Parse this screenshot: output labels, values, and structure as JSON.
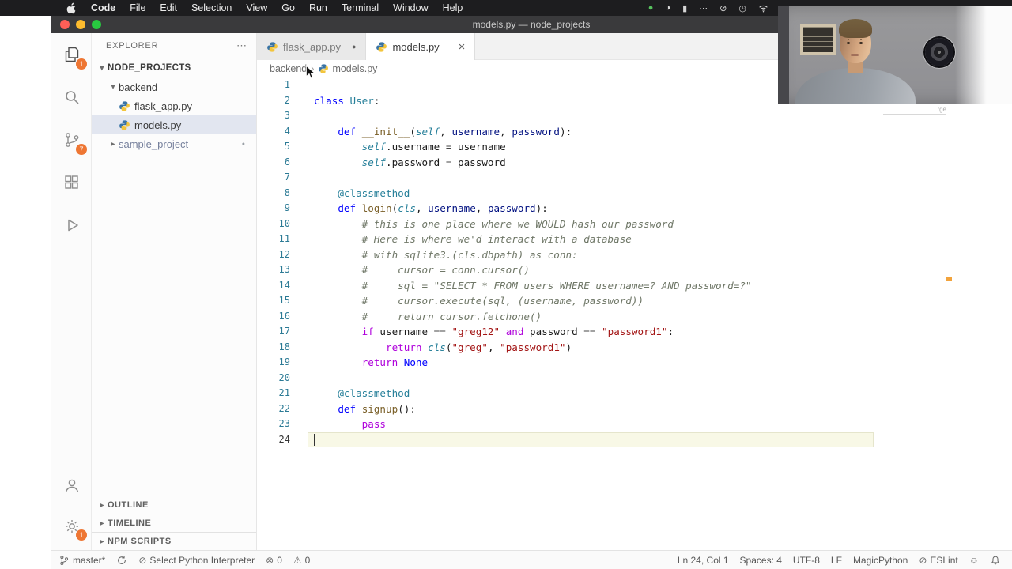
{
  "colors": {
    "badge": "#ee7633",
    "overview_marker": "#f2a33c",
    "selection": "#e2e6f0"
  },
  "icons": {
    "chevron_down": "▾",
    "chevron_right": "▸",
    "ellipsis": "⋯",
    "modified_dot": "●",
    "close": "×",
    "breadcrumb_sep": "›",
    "error": "⊗",
    "warning": "⚠",
    "blocked": "⊘",
    "smiley": "☺"
  },
  "menu_bar": {
    "items": [
      "Code",
      "File",
      "Edit",
      "Selection",
      "View",
      "Go",
      "Run",
      "Terminal",
      "Window",
      "Help"
    ],
    "status_icons": [
      {
        "name": "status-green-icon",
        "glyph": "●",
        "color": "#57c25e"
      },
      {
        "name": "status-dark-icon",
        "glyph": "◑"
      },
      {
        "name": "battery-icon",
        "glyph": "▮"
      },
      {
        "name": "more-menu-icon",
        "glyph": "⋯"
      },
      {
        "name": "dnd-icon",
        "glyph": "⊘"
      },
      {
        "name": "clock-icon",
        "glyph": "◷"
      },
      {
        "name": "wifi-icon",
        "glyph": "@wifi"
      }
    ]
  },
  "title_bar": {
    "title": "models.py — node_projects"
  },
  "activity_bar": {
    "top": [
      {
        "name": "explorer",
        "icon": "files",
        "badge": "1",
        "active": true
      },
      {
        "name": "search",
        "icon": "search"
      },
      {
        "name": "source-control",
        "icon": "scm",
        "badge": "7"
      },
      {
        "name": "extensions",
        "icon": "extensions"
      },
      {
        "name": "run-debug",
        "icon": "run"
      }
    ],
    "bottom": [
      {
        "name": "account",
        "icon": "account"
      },
      {
        "name": "settings",
        "icon": "gear",
        "badge": "1"
      }
    ]
  },
  "explorer": {
    "title": "EXPLORER",
    "root_label": "NODE_PROJECTS",
    "items": [
      {
        "label": "backend",
        "kind": "folder-open",
        "depth": 1
      },
      {
        "label": "flask_app.py",
        "kind": "file-python",
        "depth": 2
      },
      {
        "label": "models.py",
        "kind": "file-python",
        "depth": 2,
        "selected": true
      },
      {
        "label": "sample_project",
        "kind": "folder-closed",
        "depth": 1,
        "muted": true,
        "badge_dot": true
      }
    ],
    "sections": [
      "OUTLINE",
      "TIMELINE",
      "NPM SCRIPTS"
    ]
  },
  "editor_tabs": [
    {
      "label": "flask_app.py",
      "modified": true,
      "active": false
    },
    {
      "label": "models.py",
      "modified": false,
      "active": true
    }
  ],
  "breadcrumb": [
    "backend",
    "models.py"
  ],
  "editor": {
    "cursor_line": 24,
    "lines": [
      [],
      [
        [
          "kw",
          "class"
        ],
        [
          "txt",
          " "
        ],
        [
          "cls",
          "User"
        ],
        [
          "txt",
          ":"
        ]
      ],
      [],
      [
        [
          "txt",
          "    "
        ],
        [
          "kw",
          "def"
        ],
        [
          "txt",
          " "
        ],
        [
          "fn",
          "__init__"
        ],
        [
          "txt",
          "("
        ],
        [
          "self",
          "self"
        ],
        [
          "txt",
          ", "
        ],
        [
          "param",
          "username"
        ],
        [
          "txt",
          ", "
        ],
        [
          "param",
          "password"
        ],
        [
          "txt",
          "):"
        ]
      ],
      [
        [
          "txt",
          "        "
        ],
        [
          "self",
          "self"
        ],
        [
          "txt",
          ".username "
        ],
        [
          "op",
          "="
        ],
        [
          "txt",
          " username"
        ]
      ],
      [
        [
          "txt",
          "        "
        ],
        [
          "self",
          "self"
        ],
        [
          "txt",
          ".password "
        ],
        [
          "op",
          "="
        ],
        [
          "txt",
          " password"
        ]
      ],
      [],
      [
        [
          "txt",
          "    "
        ],
        [
          "dec",
          "@classmethod"
        ]
      ],
      [
        [
          "txt",
          "    "
        ],
        [
          "kw",
          "def"
        ],
        [
          "txt",
          " "
        ],
        [
          "fn",
          "login"
        ],
        [
          "txt",
          "("
        ],
        [
          "self",
          "cls"
        ],
        [
          "txt",
          ", "
        ],
        [
          "param",
          "username"
        ],
        [
          "txt",
          ", "
        ],
        [
          "param",
          "password"
        ],
        [
          "txt",
          "):"
        ]
      ],
      [
        [
          "txt",
          "        "
        ],
        [
          "com",
          "# this is one place where we WOULD hash our password"
        ]
      ],
      [
        [
          "txt",
          "        "
        ],
        [
          "com",
          "# Here is where we'd interact with a database"
        ]
      ],
      [
        [
          "txt",
          "        "
        ],
        [
          "com",
          "# with sqlite3.(cls.dbpath) as conn:"
        ]
      ],
      [
        [
          "txt",
          "        "
        ],
        [
          "com",
          "#     cursor = conn.cursor()"
        ]
      ],
      [
        [
          "txt",
          "        "
        ],
        [
          "com",
          "#     sql = \"SELECT * FROM users WHERE username=? AND password=?\""
        ]
      ],
      [
        [
          "txt",
          "        "
        ],
        [
          "com",
          "#     cursor.execute(sql, (username, password))"
        ]
      ],
      [
        [
          "txt",
          "        "
        ],
        [
          "com",
          "#     return cursor.fetchone()"
        ]
      ],
      [
        [
          "txt",
          "        "
        ],
        [
          "ctl",
          "if"
        ],
        [
          "txt",
          " username "
        ],
        [
          "op",
          "=="
        ],
        [
          "txt",
          " "
        ],
        [
          "str",
          "\"greg12\""
        ],
        [
          "txt",
          " "
        ],
        [
          "ctl",
          "and"
        ],
        [
          "txt",
          " password "
        ],
        [
          "op",
          "=="
        ],
        [
          "txt",
          " "
        ],
        [
          "str",
          "\"password1\""
        ],
        [
          "txt",
          ":"
        ]
      ],
      [
        [
          "txt",
          "            "
        ],
        [
          "ctl",
          "return"
        ],
        [
          "txt",
          " "
        ],
        [
          "self",
          "cls"
        ],
        [
          "txt",
          "("
        ],
        [
          "str",
          "\"greg\""
        ],
        [
          "txt",
          ", "
        ],
        [
          "str",
          "\"password1\""
        ],
        [
          "txt",
          ")"
        ]
      ],
      [
        [
          "txt",
          "        "
        ],
        [
          "ctl",
          "return"
        ],
        [
          "txt",
          " "
        ],
        [
          "const",
          "None"
        ]
      ],
      [],
      [
        [
          "txt",
          "    "
        ],
        [
          "dec",
          "@classmethod"
        ]
      ],
      [
        [
          "txt",
          "    "
        ],
        [
          "kw",
          "def"
        ],
        [
          "txt",
          " "
        ],
        [
          "fn",
          "signup"
        ],
        [
          "txt",
          "():"
        ]
      ],
      [
        [
          "txt",
          "        "
        ],
        [
          "ctl",
          "pass"
        ]
      ],
      []
    ]
  },
  "status_bar": {
    "left": [
      {
        "name": "branch",
        "icon": "branch",
        "label": "master*"
      },
      {
        "name": "sync",
        "icon": "sync",
        "label": ""
      },
      {
        "name": "interpreter",
        "glyph": "blocked",
        "label": "Select Python Interpreter"
      },
      {
        "name": "errors",
        "glyph": "error",
        "label": "0"
      },
      {
        "name": "warnings",
        "glyph": "warning",
        "label": "0"
      }
    ],
    "right": [
      {
        "name": "cursor-position",
        "label": "Ln 24, Col 1"
      },
      {
        "name": "indentation",
        "label": "Spaces: 4"
      },
      {
        "name": "encoding",
        "label": "UTF-8"
      },
      {
        "name": "eol",
        "label": "LF"
      },
      {
        "name": "language-mode",
        "label": "MagicPython"
      },
      {
        "name": "eslint",
        "glyph": "blocked",
        "label": "ESLint"
      },
      {
        "name": "feedback",
        "glyph": "smiley",
        "label": ""
      },
      {
        "name": "notifications",
        "icon": "bell",
        "label": ""
      }
    ]
  },
  "webcam": {
    "caption": "rge"
  }
}
